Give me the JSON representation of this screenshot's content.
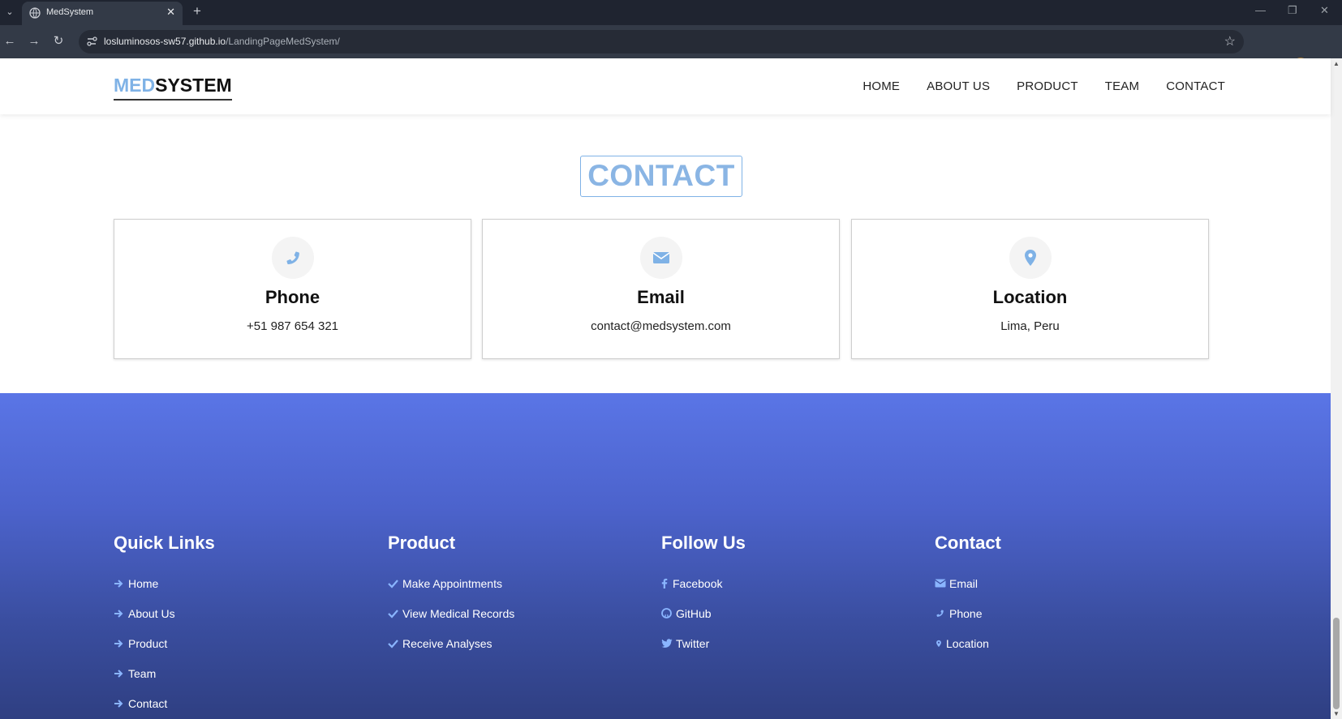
{
  "browser": {
    "tab_title": "MedSystem",
    "url_domain": "losluminosos-sw57.github.io",
    "url_path": "/LandingPageMedSystem/"
  },
  "header": {
    "logo_part1": "MED",
    "logo_part2": "SYSTEM",
    "nav": [
      "HOME",
      "ABOUT US",
      "PRODUCT",
      "TEAM",
      "CONTACT"
    ]
  },
  "contact": {
    "heading": "CONTACT",
    "cards": [
      {
        "title": "Phone",
        "value": "+51 987 654 321",
        "icon": "phone-icon"
      },
      {
        "title": "Email",
        "value": "contact@medsystem.com",
        "icon": "envelope-icon"
      },
      {
        "title": "Location",
        "value": "Lima, Peru",
        "icon": "map-marker-icon"
      }
    ]
  },
  "footer": {
    "quick_links": {
      "title": "Quick Links",
      "items": [
        "Home",
        "About Us",
        "Product",
        "Team",
        "Contact"
      ]
    },
    "product": {
      "title": "Product",
      "items": [
        "Make Appointments",
        "View Medical Records",
        "Receive Analyses"
      ]
    },
    "follow_us": {
      "title": "Follow Us",
      "items": [
        "Facebook",
        "GitHub",
        "Twitter"
      ]
    },
    "contact": {
      "title": "Contact",
      "items": [
        "Email",
        "Phone",
        "Location"
      ]
    }
  },
  "colors": {
    "accent": "#7fb2e6",
    "footer_top": "#5a75e6",
    "footer_bottom": "#2f3f82"
  }
}
